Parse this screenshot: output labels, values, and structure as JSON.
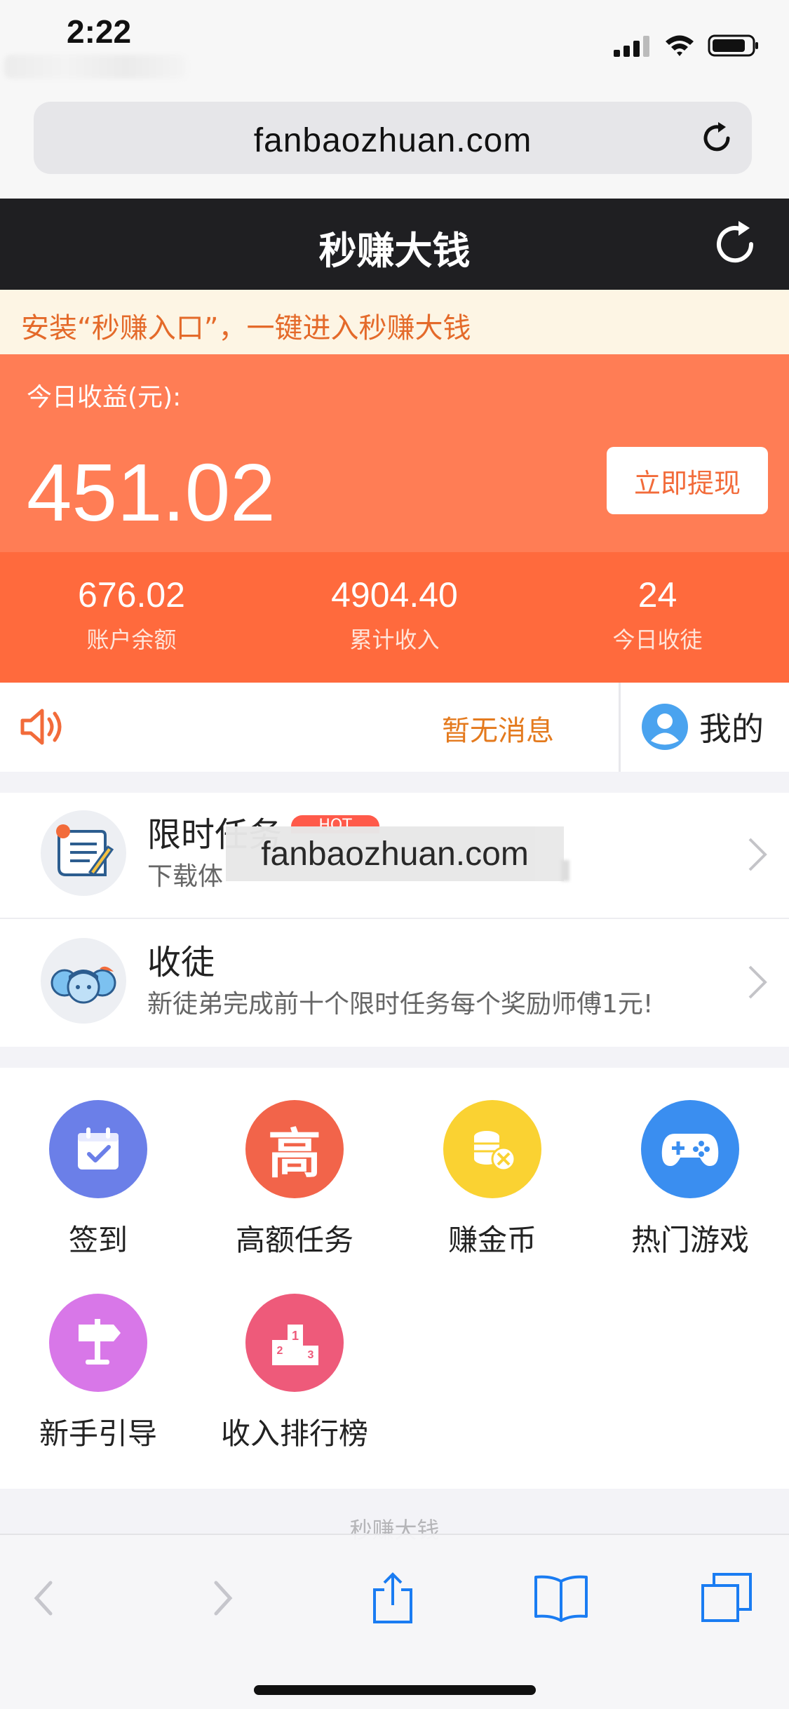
{
  "status_bar": {
    "time": "2:22"
  },
  "browser": {
    "url": "fanbaozhuan.com"
  },
  "app": {
    "title": "秒赚大钱"
  },
  "notice": {
    "text": "安装“秒赚入口”，一键进入秒赚大钱"
  },
  "earnings": {
    "today_label": "今日收益(元):",
    "today_value": "451.02",
    "withdraw_label": "立即提现",
    "stats": [
      {
        "value": "676.02",
        "label": "账户余额"
      },
      {
        "value": "4904.40",
        "label": "累计收入"
      },
      {
        "value": "24",
        "label": "今日收徒"
      }
    ]
  },
  "messages": {
    "text": "暂无消息",
    "mine_label": "我的"
  },
  "tasks": [
    {
      "title": "限时任务",
      "badge": "HOT",
      "desc": "下载体",
      "overlay": "fanbaozhuan.com"
    },
    {
      "title": "收徒",
      "desc": "新徒弟完成前十个限时任务每个奖励师傅1元!"
    }
  ],
  "grid": [
    {
      "label": "签到",
      "icon": "calendar-check-icon",
      "color": "#6b7fe8"
    },
    {
      "label": "高额任务",
      "icon": "gao-character-icon",
      "color": "#f2644a",
      "glyph": "高"
    },
    {
      "label": "赚金币",
      "icon": "coins-icon",
      "color": "#fad232"
    },
    {
      "label": "热门游戏",
      "icon": "gamepad-icon",
      "color": "#3a8ef0"
    },
    {
      "label": "新手引导",
      "icon": "signpost-icon",
      "color": "#d877e8"
    },
    {
      "label": "收入排行榜",
      "icon": "podium-icon",
      "color": "#ee5a7a"
    }
  ],
  "footer": {
    "text": "秒赚大钱"
  }
}
